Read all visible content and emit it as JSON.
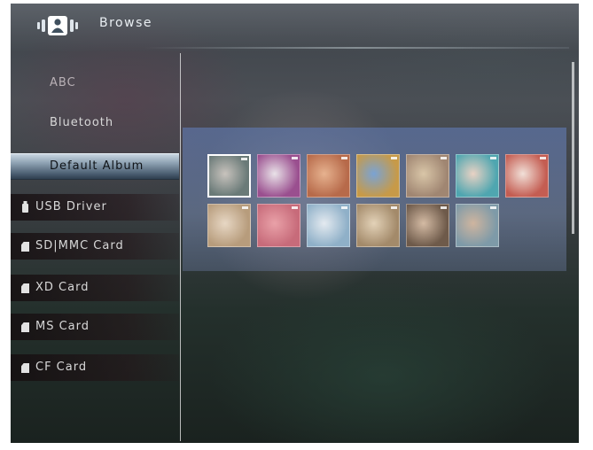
{
  "header": {
    "title": "Browse",
    "icon": "album-browse-icon"
  },
  "sidebar": {
    "items": [
      {
        "label": "ABC",
        "icon": null
      },
      {
        "label": "Bluetooth",
        "icon": null
      },
      {
        "label": "Default Album",
        "icon": null,
        "selected": true
      },
      {
        "label": "USB Driver",
        "icon": "usb-icon"
      },
      {
        "label": "SD|MMC Card",
        "icon": "memory-card-icon"
      },
      {
        "label": "XD Card",
        "icon": "memory-card-icon"
      },
      {
        "label": "MS Card",
        "icon": "memory-card-icon"
      },
      {
        "label": "CF Card",
        "icon": "memory-card-icon"
      }
    ]
  },
  "thumbnails": {
    "count": 13,
    "selected_index": 0,
    "colors": [
      [
        "#6a7a78",
        "#c8c3bd"
      ],
      [
        "#9a4f8f",
        "#e9e2e8"
      ],
      [
        "#b76a4a",
        "#e6b28f"
      ],
      [
        "#c79a48",
        "#7aa3d4"
      ],
      [
        "#a08672",
        "#d9c6a8"
      ],
      [
        "#4fa6b0",
        "#e9d2c4"
      ],
      [
        "#c45d52",
        "#f1e0d8"
      ],
      [
        "#b79c7c",
        "#e7d7c4"
      ],
      [
        "#c76b7a",
        "#e9a1a8"
      ],
      [
        "#8fb0c8",
        "#e4eaf0"
      ],
      [
        "#a38a6a",
        "#e3d2b8"
      ],
      [
        "#6e5a4a",
        "#d4bba4"
      ],
      [
        "#7e9aa8",
        "#cfb59f"
      ]
    ]
  }
}
